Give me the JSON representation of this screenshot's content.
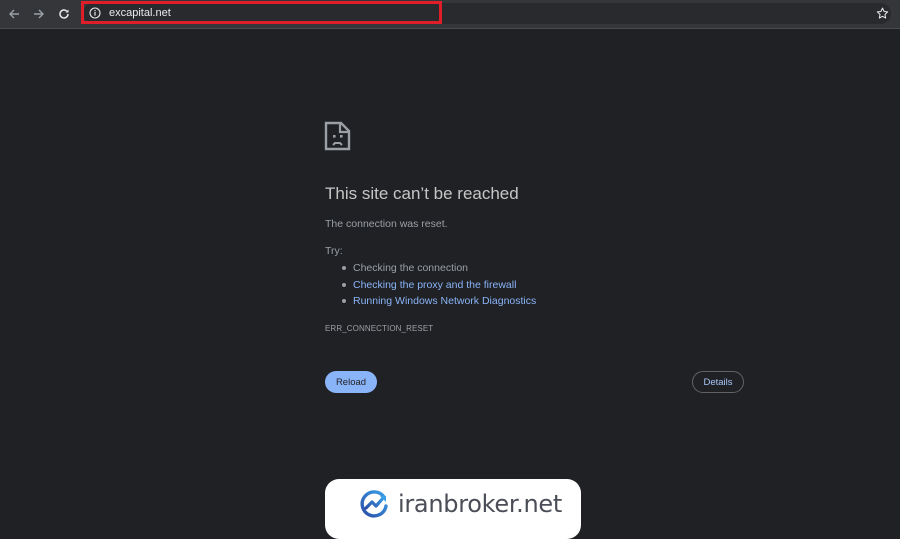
{
  "browser": {
    "back_icon": "back-arrow-icon",
    "forward_icon": "forward-arrow-icon",
    "reload_icon": "reload-icon",
    "site_info_icon": "info-icon",
    "bookmark_icon": "star-icon",
    "url": "excapital.net",
    "highlight_color": "#e01e2a"
  },
  "error_page": {
    "icon": "sad-file-icon",
    "title": "This site can’t be reached",
    "description": "The connection was reset.",
    "try_label": "Try:",
    "suggestions": [
      {
        "text": "Checking the connection",
        "is_link": false
      },
      {
        "text": "Checking the proxy and the firewall",
        "is_link": true
      },
      {
        "text": "Running Windows Network Diagnostics",
        "is_link": true
      }
    ],
    "error_code": "ERR_CONNECTION_RESET",
    "reload_label": "Reload",
    "details_label": "Details",
    "accent_color": "#8ab4f8"
  },
  "watermark": {
    "text": "iranbroker.net",
    "logo_icon": "iranbroker-logo-icon"
  }
}
